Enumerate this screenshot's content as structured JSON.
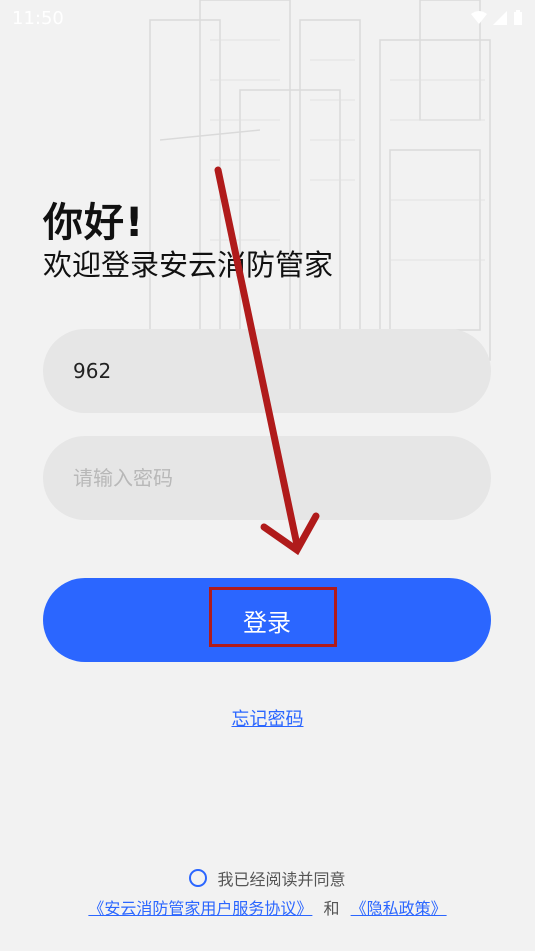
{
  "status": {
    "time": "11:50"
  },
  "greeting": {
    "title": "你好!",
    "subtitle": "欢迎登录安云消防管家"
  },
  "form": {
    "account_value": "962",
    "password_placeholder": "请输入密码",
    "login_label": "登录"
  },
  "forgot_label": "忘记密码",
  "agreement": {
    "text": "我已经阅读并同意",
    "terms_link": "《安云消防管家用户服务协议》",
    "and": "和",
    "privacy_link": "《隐私政策》"
  },
  "colors": {
    "primary": "#2b66ff",
    "annotation": "#b01b1b",
    "field_bg": "#e6e6e6"
  }
}
